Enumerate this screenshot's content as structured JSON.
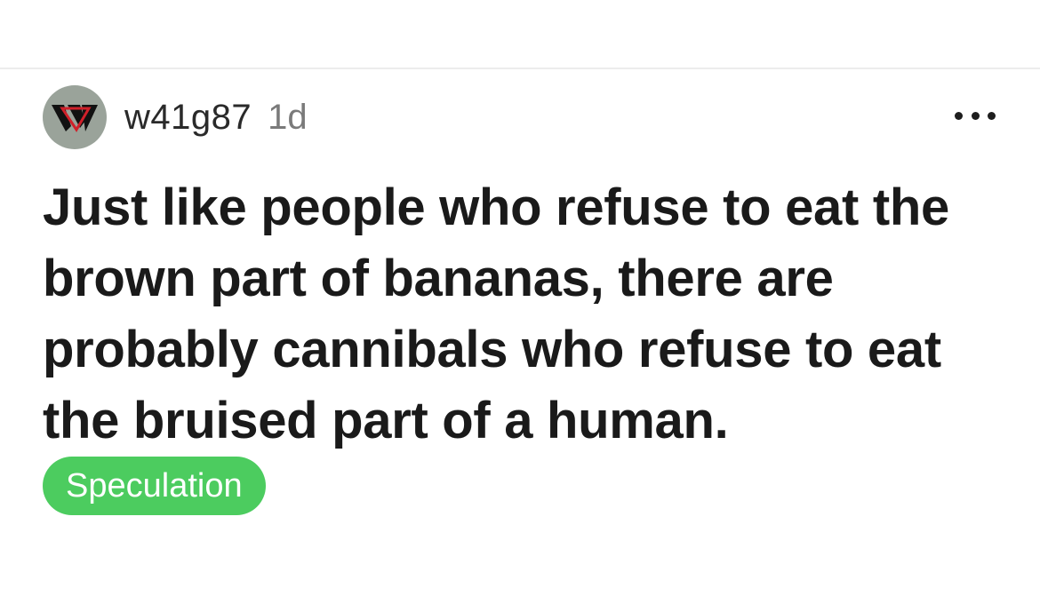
{
  "post": {
    "username": "w41g87",
    "timestamp": "1d",
    "body": "Just like people who refuse to eat the brown part of bananas, there are probably cannibals who refuse to eat the bruised part of a human.",
    "flair": "Speculation",
    "more_icon": "ellipsis-icon",
    "avatar_icon": "w-logo-icon"
  },
  "colors": {
    "flair_background": "#4ccc5f",
    "flair_text": "#ffffff",
    "avatar_background": "#9aa39a",
    "body_text": "#1a1a1a",
    "username_text": "#2a2a2a",
    "timestamp_text": "#7a7a7a"
  }
}
